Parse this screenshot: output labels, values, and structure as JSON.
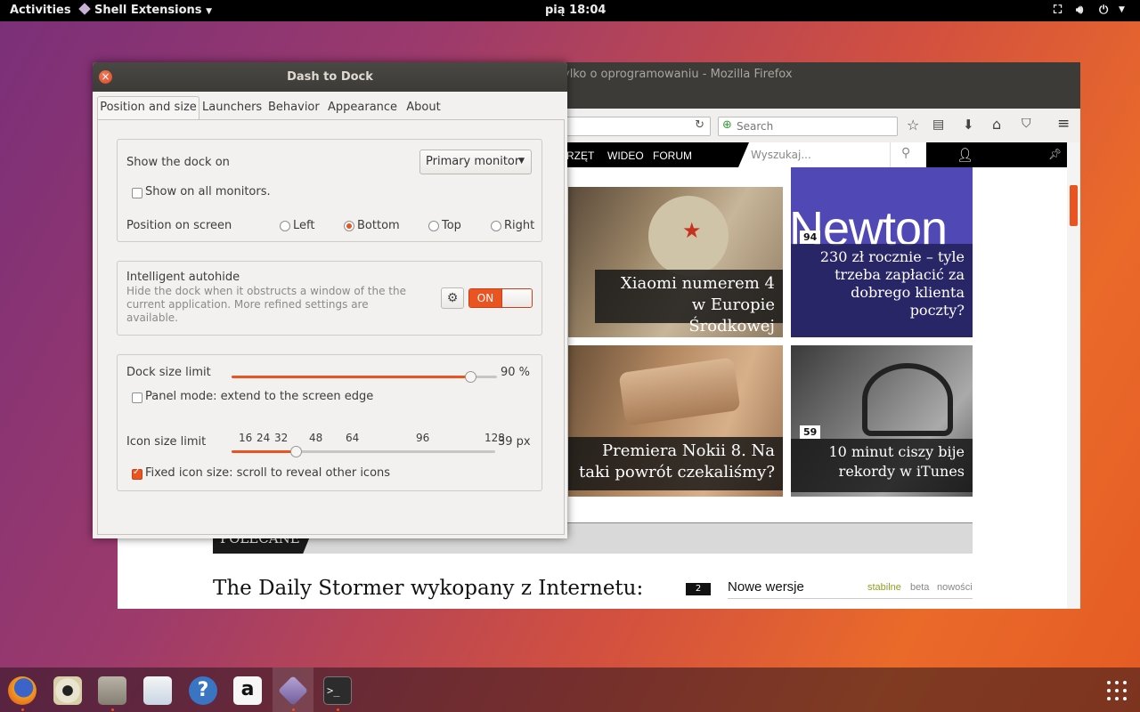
{
  "topbar": {
    "activities": "Activities",
    "app_menu": "Shell Extensions",
    "clock": "pią 18:04"
  },
  "firefox": {
    "title": "ylko o oprogramowaniu - Mozilla Firefox",
    "search_placeholder": "Search",
    "nav_items": [
      "RZĘT",
      "WIDEO",
      "FORUM"
    ],
    "site_search_placeholder": "Wyszukaj...",
    "tiles": {
      "t1": "Xiaomi numerem 4 w Europie Środkowej",
      "t2_badge": "94",
      "t2_logo": "Newton",
      "t2": "230 zł rocznie – tyle trzeba zapłacić za dobrego klienta poczty?",
      "t3": "Premiera Nokii 8. Na taki powrót czekaliśmy?",
      "t4_badge": "59",
      "t4": "10 minut ciszy bije rekordy w iTunes"
    },
    "section_label": "POLECANE",
    "headline": "The Daily Stormer wykopany z Internetu:",
    "counter": "2",
    "versions_title": "Nowe wersje",
    "versions_tabs": [
      "stabilne",
      "beta",
      "nowości"
    ]
  },
  "dialog": {
    "title": "Dash to Dock",
    "tabs": [
      "Position and size",
      "Launchers",
      "Behavior",
      "Appearance",
      "About"
    ],
    "show_dock_on": "Show the dock on",
    "monitor_value": "Primary monitor",
    "show_all_monitors": "Show on all monitors.",
    "show_all_monitors_checked": false,
    "position_label": "Position on screen",
    "positions": [
      "Left",
      "Bottom",
      "Top",
      "Right"
    ],
    "position_selected": "Bottom",
    "autohide_title": "Intelligent autohide",
    "autohide_desc": "Hide the dock when it obstructs a window of the the current application. More refined settings are available.",
    "autohide_toggle": "ON",
    "dock_size_label": "Dock size limit",
    "dock_size_value": "90 %",
    "dock_size_fraction": 0.9,
    "panel_mode": "Panel mode: extend to the screen edge",
    "panel_mode_checked": false,
    "icon_size_label": "Icon size limit",
    "icon_ticks": [
      "16",
      "24",
      "32",
      "48",
      "64",
      "96",
      "128"
    ],
    "icon_size_value": "39 px",
    "fixed_icon": "Fixed icon size: scroll to reveal other icons",
    "fixed_icon_checked": true
  },
  "dock": {
    "apps": [
      "firefox-icon",
      "rhythmbox-icon",
      "files-icon",
      "software-icon",
      "help-icon",
      "amazon-icon",
      "shell-extensions-icon",
      "terminal-icon"
    ],
    "accent": "#e95420"
  }
}
